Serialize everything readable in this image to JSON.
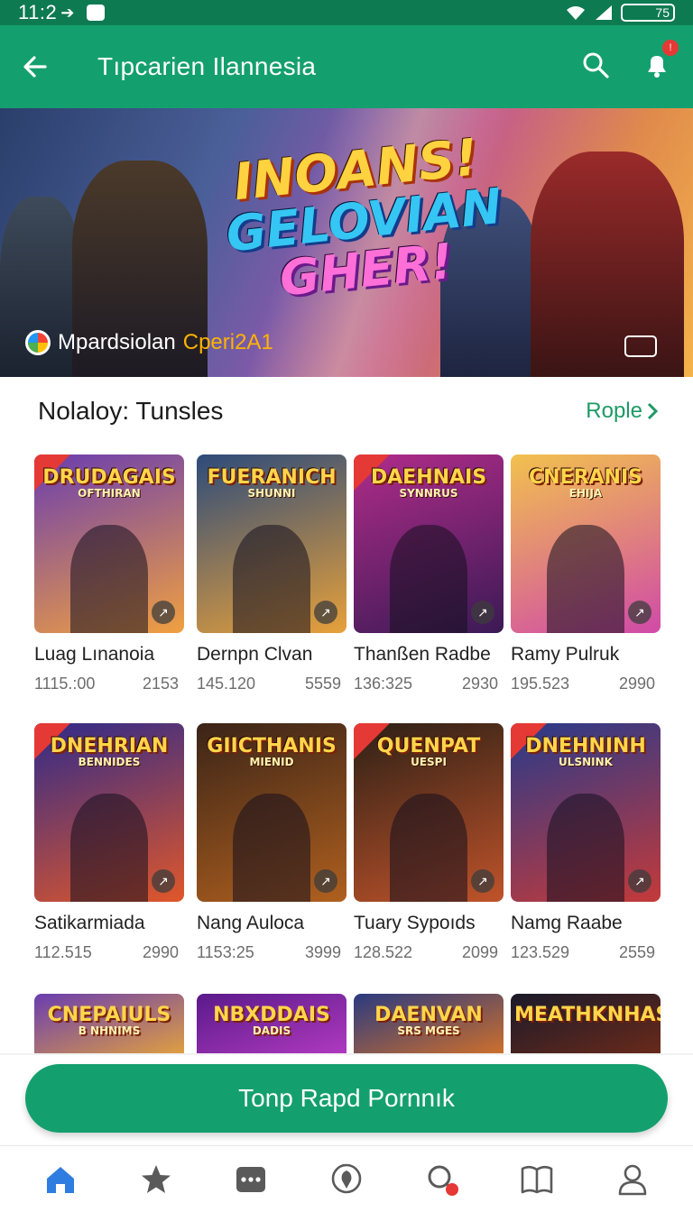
{
  "status_bar": {
    "time": "11:2",
    "battery": "75"
  },
  "app_bar": {
    "title": "Tıpcarien Ilannesia",
    "notification_count": "!"
  },
  "banner": {
    "title_lines": [
      "INOANS!",
      "GELOVIAN",
      "GHER!"
    ],
    "brand_name": "Mpardsiolan",
    "brand_tag": "Cperi2A1"
  },
  "section": {
    "title": "Nolaloy: Tunsles",
    "more_label": "Rople"
  },
  "games": [
    {
      "art_title": "DRUDAGAIS",
      "art_sub": "OFTHIRAN",
      "name": "Luag Lınanoia",
      "stat_a": "1115.:00",
      "stat_b": "2153",
      "bg": [
        "#6a3db0",
        "#f0a040"
      ],
      "corner": true
    },
    {
      "art_title": "FUERANICH",
      "art_sub": "SHUNNI",
      "name": "Dernpn Clvan",
      "stat_a": "145.120",
      "stat_b": "5559",
      "bg": [
        "#2d4b7a",
        "#e7a13a"
      ],
      "corner": false
    },
    {
      "art_title": "DAEHNAIS",
      "art_sub": "SYNNRUS",
      "name": "Thanßen Radbe",
      "stat_a": "136:325",
      "stat_b": "2930",
      "bg": [
        "#b02c8a",
        "#3b1a55"
      ],
      "corner": true
    },
    {
      "art_title": "CNERANIS",
      "art_sub": "EHIJA",
      "name": "Ramy Pulruk",
      "stat_a": "195.523",
      "stat_b": "2990",
      "bg": [
        "#f2c14e",
        "#d04aa8"
      ],
      "corner": false
    },
    {
      "art_title": "DNEHRIAN",
      "art_sub": "BENNIDES",
      "name": "Satikarmiada",
      "stat_a": "112.515",
      "stat_b": "2990",
      "bg": [
        "#2f2a8a",
        "#e0572a"
      ],
      "corner": true
    },
    {
      "art_title": "GIICTHANIS",
      "art_sub": "MIENID",
      "name": "Nang Auloca",
      "stat_a": "1153:25",
      "stat_b": "3999",
      "bg": [
        "#3a2418",
        "#b0601e"
      ],
      "corner": false
    },
    {
      "art_title": "QUENPAT",
      "art_sub": "UESPI",
      "name": "Tuary Sypoıds",
      "stat_a": "128.522",
      "stat_b": "2099",
      "bg": [
        "#2c2016",
        "#c0532a"
      ],
      "corner": true
    },
    {
      "art_title": "DNEHNINH",
      "art_sub": "ULSNINK",
      "name": "Namg Raabe",
      "stat_a": "123.529",
      "stat_b": "2559",
      "bg": [
        "#283a8a",
        "#c43a3a"
      ],
      "corner": true
    }
  ],
  "partials": [
    {
      "art_title": "CNEPAIULS",
      "art_sub": "B NHNIMS",
      "bg": [
        "#6a3db0",
        "#e0a040"
      ]
    },
    {
      "art_title": "NBXDDAIS",
      "art_sub": "DADIS",
      "bg": [
        "#5a1a8a",
        "#b03ac0"
      ]
    },
    {
      "art_title": "DAENVAN",
      "art_sub": "SRS MGES",
      "bg": [
        "#2a3a80",
        "#d0702a"
      ]
    },
    {
      "art_title": "MEATHKNHAS",
      "art_sub": "",
      "bg": [
        "#1a1a2a",
        "#6a2a1a"
      ]
    }
  ],
  "cta": {
    "label": "Tonp Rapd Pornnık"
  },
  "nav": [
    "home-icon",
    "star-icon",
    "chat-icon",
    "award-icon",
    "search-icon",
    "book-icon",
    "profile-icon"
  ],
  "colors": {
    "primary": "#14a06e",
    "primary_dark": "#0e7a52",
    "accent_red": "#e53935",
    "link_green": "#1d9a66"
  }
}
